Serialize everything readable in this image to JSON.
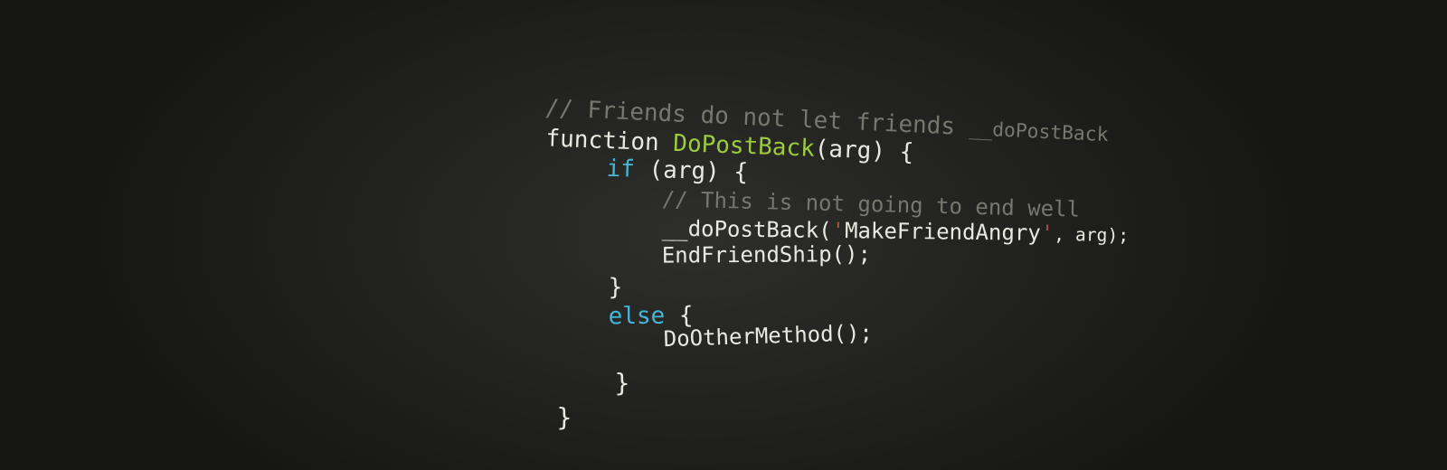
{
  "code": {
    "comment1": "// Friends do not let friends",
    "comment1_tail": "__doPostBack",
    "kw_function": "function",
    "fn_name": "DoPostBack",
    "fn_sig": "(arg) {",
    "kw_if": "if",
    "if_cond": "(arg) {",
    "comment2": "// This is not going to end well",
    "postback_call": "__doPostBack(",
    "quote_open": "'",
    "postback_arg1": "MakeFriendAngry",
    "quote_close": "'",
    "postback_args_end": ", arg);",
    "end_friendship": "EndFriendShip();",
    "close_if": "}",
    "kw_else": "else",
    "else_open": "{",
    "do_other": "DoOtherMethod();",
    "close_else": "}",
    "close_function": "}"
  },
  "colors": {
    "background": "#232321",
    "text": "#e9e9e2",
    "comment": "#77776f",
    "function_name": "#9ccb3f",
    "keyword": "#45b5d8",
    "string_quote": "#a1523f"
  }
}
